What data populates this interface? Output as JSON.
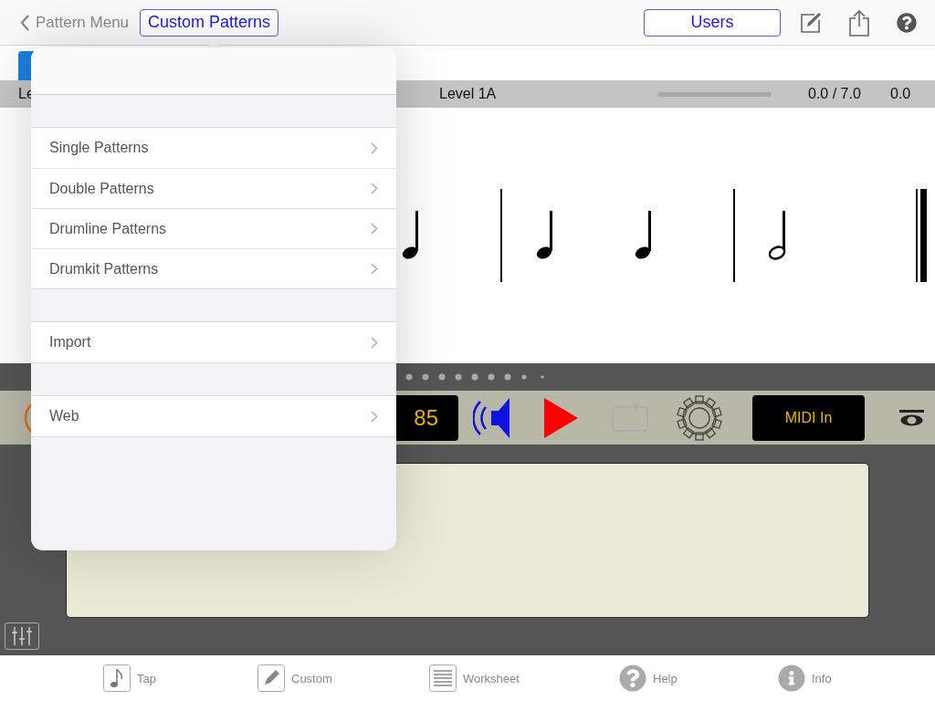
{
  "nav": {
    "back_label": "Pattern Menu",
    "title_button": "Custom Patterns",
    "users_button": "Users"
  },
  "level_bar": {
    "left_label": "Le",
    "level_label": "Level 1A",
    "progress": {
      "level": 0
    },
    "score": "0.0 / 7.0",
    "value": "0.0"
  },
  "score": {
    "symbols": [
      {
        "kind": "quarter"
      },
      {
        "kind": "barline"
      },
      {
        "kind": "quarter"
      },
      {
        "kind": "quarter"
      },
      {
        "kind": "barline"
      },
      {
        "kind": "half"
      },
      {
        "kind": "final_barline"
      }
    ]
  },
  "controls": {
    "tempo": "85",
    "midi_button": "MIDI In"
  },
  "tab_bar": [
    {
      "kind": "note",
      "label": "Tap"
    },
    {
      "kind": "pencil",
      "label": "Custom"
    },
    {
      "kind": "lines",
      "label": "Worksheet"
    },
    {
      "kind": "help",
      "label": "Help"
    },
    {
      "kind": "info",
      "label": "Info"
    }
  ],
  "popover": {
    "sections": [
      {
        "items": [
          {
            "label": "Single Patterns"
          },
          {
            "label": "Double Patterns"
          },
          {
            "label": "Drumline Patterns"
          },
          {
            "label": "Drumkit Patterns"
          }
        ]
      },
      {
        "items": [
          {
            "label": "Import"
          }
        ]
      },
      {
        "items": [
          {
            "label": "Web"
          }
        ]
      }
    ]
  }
}
